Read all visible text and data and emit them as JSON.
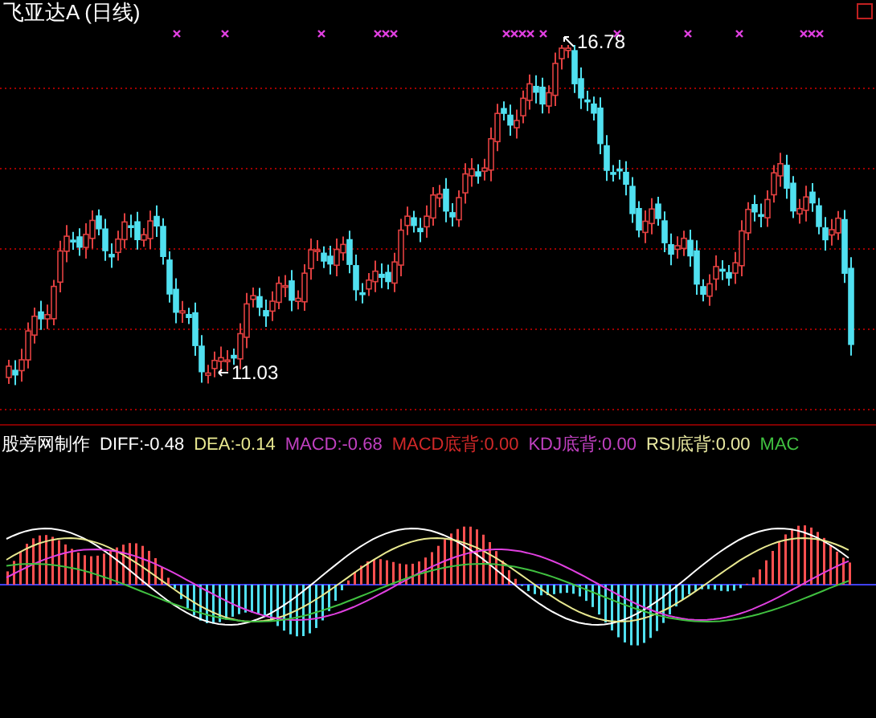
{
  "title": "飞亚达A (日线)",
  "high_label": "16.78",
  "low_label": "11.03",
  "indicators": [
    {
      "text": "股旁网制作",
      "color": "#ffffff"
    },
    {
      "text": "DIFF:-0.48",
      "color": "#ffffff"
    },
    {
      "text": "DEA:-0.14",
      "color": "#e8e890"
    },
    {
      "text": "MACD:-0.68",
      "color": "#c040c0"
    },
    {
      "text": "MACD底背:0.00",
      "color": "#d02828"
    },
    {
      "text": "KDJ底背:0.00",
      "color": "#c040c0"
    },
    {
      "text": "RSI底背:0.00",
      "color": "#e8e8a0"
    },
    {
      "text": "MAC",
      "color": "#40c040"
    }
  ]
}
